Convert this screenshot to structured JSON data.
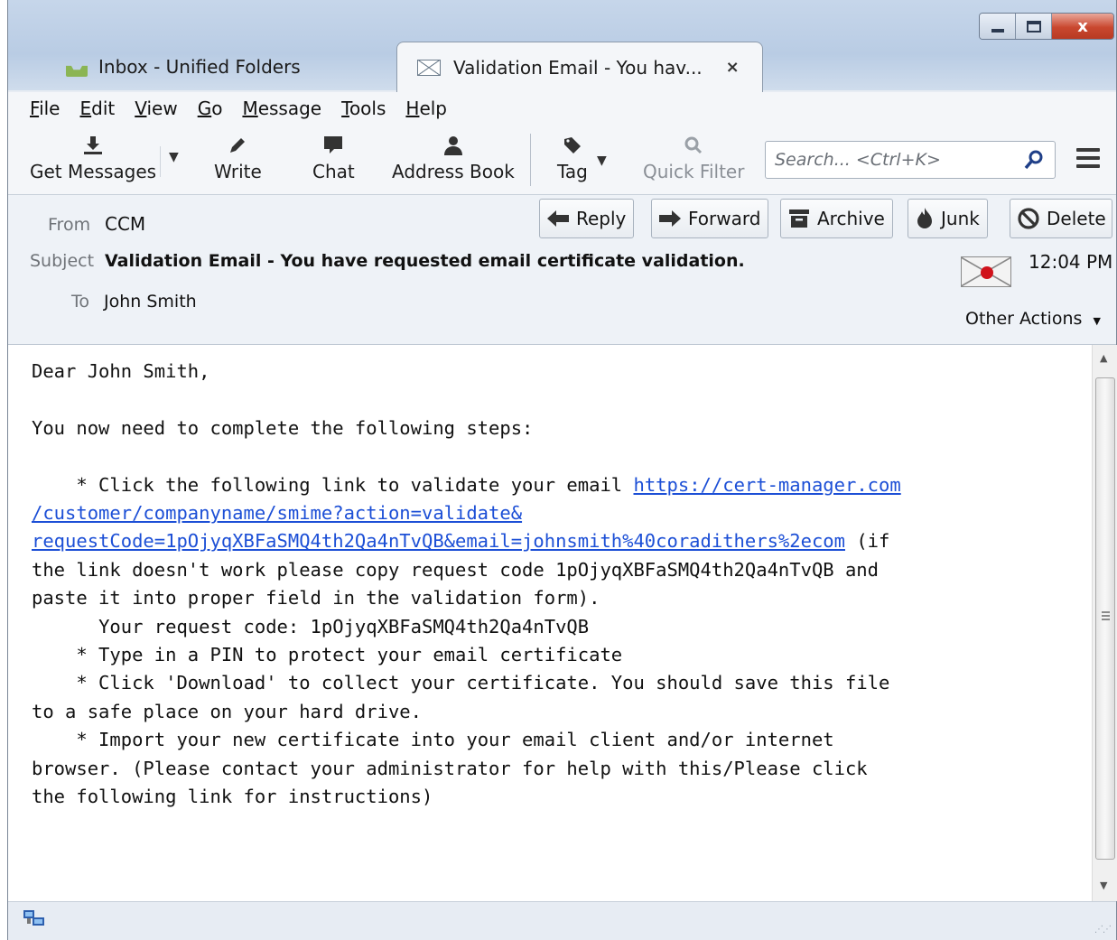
{
  "window": {
    "controls": {
      "close_glyph": "x"
    }
  },
  "tabs": [
    {
      "label": "Inbox - Unified Folders",
      "icon": "inbox-download-icon",
      "active": false
    },
    {
      "label": "Validation Email - You hav...",
      "icon": "envelope-icon",
      "active": true,
      "close_glyph": "×"
    }
  ],
  "menu": [
    "File",
    "Edit",
    "View",
    "Go",
    "Message",
    "Tools",
    "Help"
  ],
  "toolbar": {
    "get_messages": "Get Messages",
    "write": "Write",
    "chat": "Chat",
    "address_book": "Address Book",
    "tag": "Tag",
    "quick_filter": "Quick Filter",
    "search_placeholder": "Search... <Ctrl+K>"
  },
  "header": {
    "from_label": "From",
    "from_value": "CCM",
    "subject_label": "Subject",
    "subject_value": "Validation Email - You have requested email certificate validation.",
    "to_label": "To",
    "to_value": "John Smith",
    "time": "12:04 PM",
    "other_actions": "Other Actions",
    "buttons": {
      "reply": "Reply",
      "forward": "Forward",
      "archive": "Archive",
      "junk": "Junk",
      "delete": "Delete"
    }
  },
  "message": {
    "greeting": "Dear John Smith,",
    "intro": "You now need to complete the following steps:",
    "step1_prefix": "    * Click the following link to validate your email ",
    "link": "https://cert-manager.com/customer/companyname/smime?action=validate&requestCode=1pOjyqXBFaSMQ4th2Qa4nTvQB&email=johnsmith%40coradithers%2ecom",
    "link_lines": [
      "https://cert-manager.com",
      "/customer/companyname/smime?action=validate&",
      "requestCode=1pOjyqXBFaSMQ4th2Qa4nTvQB&email=johnsmith%40coradithers%2ecom"
    ],
    "step1_suffix": " (if\nthe link doesn't work please copy request code 1pOjyqXBFaSMQ4th2Qa4nTvQB and\npaste it into proper field in the validation form).",
    "request_code_line": "      Your request code: 1pOjyqXBFaSMQ4th2Qa4nTvQB",
    "step2": "    * Type in a PIN to protect your email certificate",
    "step3": "    * Click 'Download' to collect your certificate. You should save this file\nto a safe place on your hard drive.",
    "step4": "    * Import your new certificate into your email client and/or internet\nbrowser. (Please contact your administrator for help with this/Please click\nthe following link for instructions)"
  }
}
